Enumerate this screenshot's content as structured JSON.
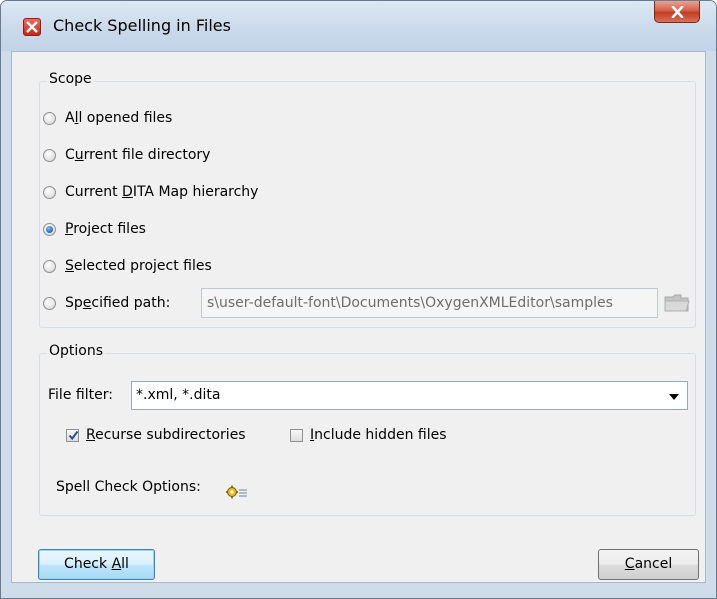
{
  "window": {
    "title": "Check Spelling in Files"
  },
  "scope": {
    "title": "Scope",
    "options": [
      {
        "pre": "A",
        "key": "l",
        "post": "l opened files",
        "selected": false
      },
      {
        "pre": "C",
        "key": "u",
        "post": "rrent file directory",
        "selected": false
      },
      {
        "pre": "Current ",
        "key": "D",
        "post": "ITA Map hierarchy",
        "selected": false
      },
      {
        "pre": "",
        "key": "P",
        "post": "roject files",
        "selected": true
      },
      {
        "pre": "",
        "key": "S",
        "post": "elected project files",
        "selected": false
      },
      {
        "pre": "Sp",
        "key": "e",
        "post": "cified path:",
        "selected": false
      }
    ],
    "specified_path_value": "s\\user-default-font\\Documents\\OxygenXMLEditor\\samples"
  },
  "options": {
    "title": "Options",
    "file_filter_label": "File filter:",
    "file_filter_value": "*.xml, *.dita",
    "recurse": {
      "key": "R",
      "post": "ecurse subdirectories",
      "checked": true
    },
    "hidden": {
      "key": "I",
      "post": "nclude hidden files",
      "checked": false
    },
    "spell_check_label": "Spell Check Options:"
  },
  "buttons": {
    "check_all": {
      "pre": "Check ",
      "key": "A",
      "post": "ll"
    },
    "cancel": {
      "pre": "",
      "key": "C",
      "post": "ancel"
    }
  },
  "colors": {
    "title_bar": "#c9d9ea",
    "close_button": "#c13c22",
    "radio_selected": "#1a66b8",
    "default_button_border": "#3c7fb1"
  },
  "icons": {
    "app": "oxygen-app-icon",
    "close": "close-icon",
    "folder": "folder-icon",
    "settings": "gear-icon"
  }
}
